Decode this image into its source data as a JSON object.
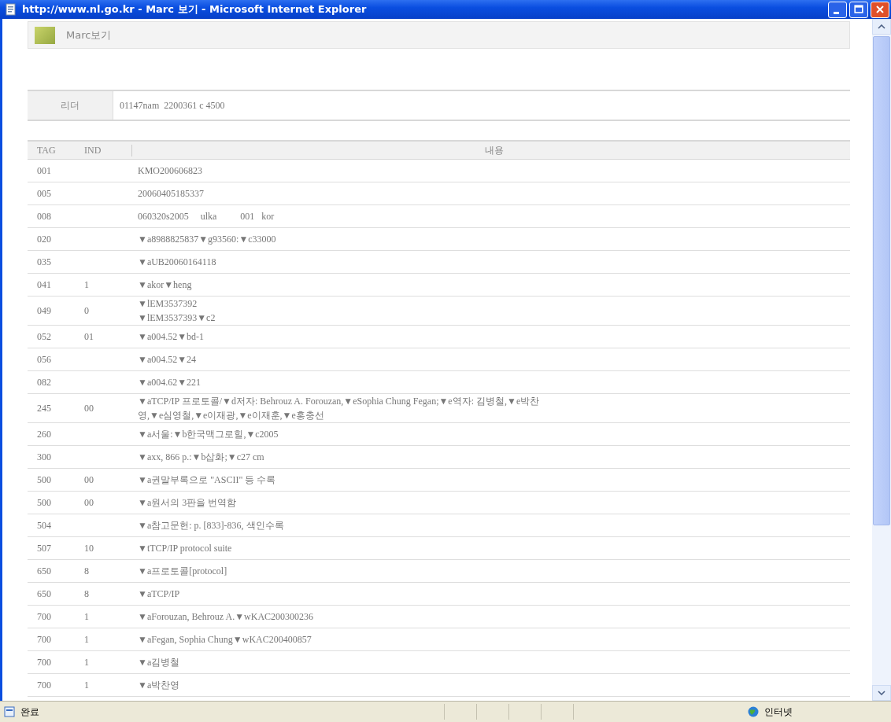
{
  "window": {
    "title": "http://www.nl.go.kr - Marc 보기 - Microsoft Internet Explorer"
  },
  "panel": {
    "title": "Marc보기"
  },
  "leader": {
    "label": "리더",
    "value": "01147nam  2200361 c 4500"
  },
  "table": {
    "columns": [
      "TAG",
      "IND",
      "내용"
    ],
    "rows": [
      {
        "tag": "001",
        "ind": "",
        "lines": [
          "KMO200606823"
        ]
      },
      {
        "tag": "005",
        "ind": "",
        "lines": [
          "20060405185337"
        ]
      },
      {
        "tag": "008",
        "ind": "",
        "lines": [
          "060320s2005     ulka          001   kor"
        ]
      },
      {
        "tag": "020",
        "ind": "",
        "lines": [
          "▼a8988825837▼g93560:▼c33000"
        ]
      },
      {
        "tag": "035",
        "ind": "",
        "lines": [
          "▼aUB20060164118"
        ]
      },
      {
        "tag": "041",
        "ind": "1",
        "lines": [
          "▼akor▼heng"
        ]
      },
      {
        "tag": "049",
        "ind": "0",
        "lines": [
          "▼lEM3537392",
          "▼lEM3537393▼c2"
        ]
      },
      {
        "tag": "052",
        "ind": "01",
        "lines": [
          "▼a004.52▼bd-1"
        ]
      },
      {
        "tag": "056",
        "ind": "",
        "lines": [
          "▼a004.52▼24"
        ]
      },
      {
        "tag": "082",
        "ind": "",
        "lines": [
          "▼a004.62▼221"
        ]
      },
      {
        "tag": "245",
        "ind": "00",
        "lines": [
          "▼aTCP/IP 프로토콜/▼d저자: Behrouz A. Forouzan,▼eSophia Chung Fegan;▼e역자: 김병철,▼e박찬",
          "영,▼e심영철,▼e이재광,▼e이재훈,▼e홍충선"
        ]
      },
      {
        "tag": "260",
        "ind": "",
        "lines": [
          "▼a서울:▼b한국맥그로힐,▼c2005"
        ]
      },
      {
        "tag": "300",
        "ind": "",
        "lines": [
          "▼axx, 866 p.:▼b삽화;▼c27 cm"
        ]
      },
      {
        "tag": "500",
        "ind": "00",
        "lines": [
          "▼a권말부록으로 \"ASCII\" 등 수록"
        ]
      },
      {
        "tag": "500",
        "ind": "00",
        "lines": [
          "▼a원서의 3판을 번역함"
        ]
      },
      {
        "tag": "504",
        "ind": "",
        "lines": [
          "▼a참고문헌: p. [833]-836, 색인수록"
        ]
      },
      {
        "tag": "507",
        "ind": "10",
        "lines": [
          "▼tTCP/IP protocol suite"
        ]
      },
      {
        "tag": "650",
        "ind": "8",
        "lines": [
          "▼a프로토콜[protocol]"
        ]
      },
      {
        "tag": "650",
        "ind": "8",
        "lines": [
          "▼aTCP/IP"
        ]
      },
      {
        "tag": "700",
        "ind": "1",
        "lines": [
          "▼aForouzan, Behrouz A.▼wKAC200300236"
        ]
      },
      {
        "tag": "700",
        "ind": "1",
        "lines": [
          "▼aFegan, Sophia Chung▼wKAC200400857"
        ]
      },
      {
        "tag": "700",
        "ind": "1",
        "lines": [
          "▼a김병철"
        ]
      },
      {
        "tag": "700",
        "ind": "1",
        "lines": [
          "▼a박찬영"
        ]
      }
    ]
  },
  "status_bar": {
    "text": "완료",
    "zone": "인터넷"
  }
}
